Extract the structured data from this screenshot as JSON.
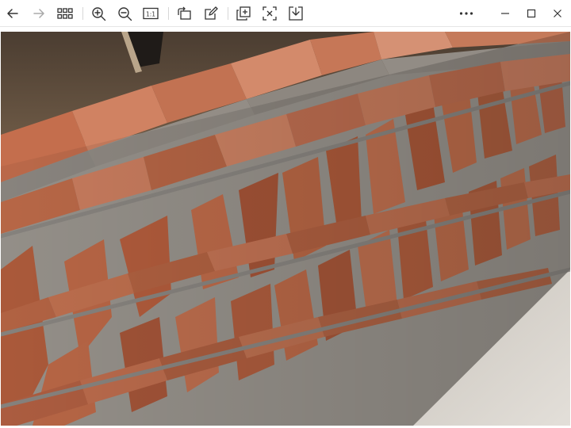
{
  "toolbar": {
    "icons": [
      "back-arrow-icon",
      "forward-arrow-icon",
      "grid-view-icon",
      "zoom-in-icon",
      "zoom-out-icon",
      "actual-size-icon",
      "rotate-icon",
      "edit-icon",
      "copy-icon",
      "crop-icon",
      "save-icon",
      "more-icon",
      "minimize-icon",
      "maximize-icon",
      "close-icon"
    ],
    "actual_size_label": "1:1"
  },
  "photo": {
    "subject": "",
    "colors": {
      "brick": "#b5603f",
      "brick_light": "#c9785a",
      "mortar": "#9a9a96",
      "ground": "#d6d2cb",
      "soil": "#5b4a3a"
    }
  }
}
